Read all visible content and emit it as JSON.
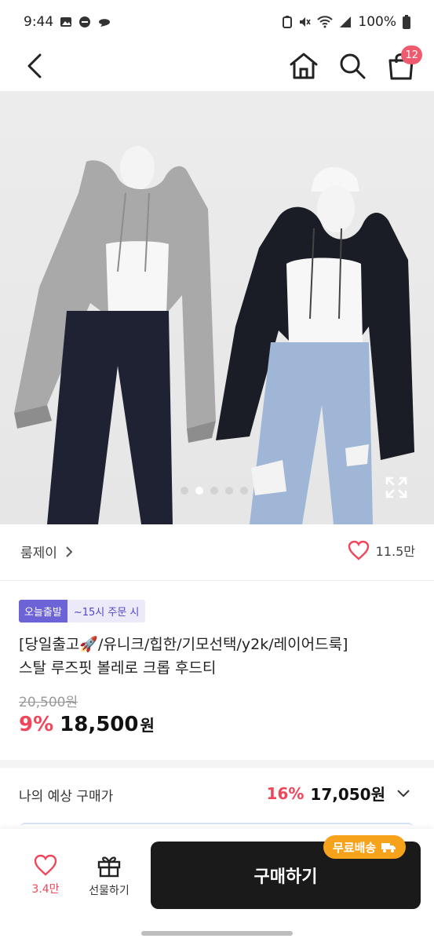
{
  "status_bar": {
    "time": "9:44",
    "battery": "100%"
  },
  "header": {
    "cart_count": "12"
  },
  "carousel": {
    "slide_count": 5,
    "active_index": 1
  },
  "brand": {
    "name": "룸제이",
    "like_count": "11.5만"
  },
  "badges": {
    "today": "오늘출발",
    "time": "~15시 주문 시"
  },
  "product": {
    "title_line1": "[당일출고🚀/유니크/힙한/기모선택/y2k/레이어드룩]",
    "title_line2": "스탈 루즈핏 볼레로 크롭 후드티",
    "original_price": "20,500원",
    "discount": "9%",
    "price": "18,500",
    "currency": "원"
  },
  "expected": {
    "label": "나의 예상 구매가",
    "discount": "16%",
    "price": "17,050원"
  },
  "bottom_bar": {
    "wish_count": "3.4만",
    "gift_label": "선물하기",
    "buy_label": "구매하기",
    "free_shipping": "무료배송"
  },
  "colors": {
    "accent": "#f0465a",
    "badge": "#6b63d6",
    "shipping": "#f7a21b",
    "buy": "#1a1a1a"
  }
}
